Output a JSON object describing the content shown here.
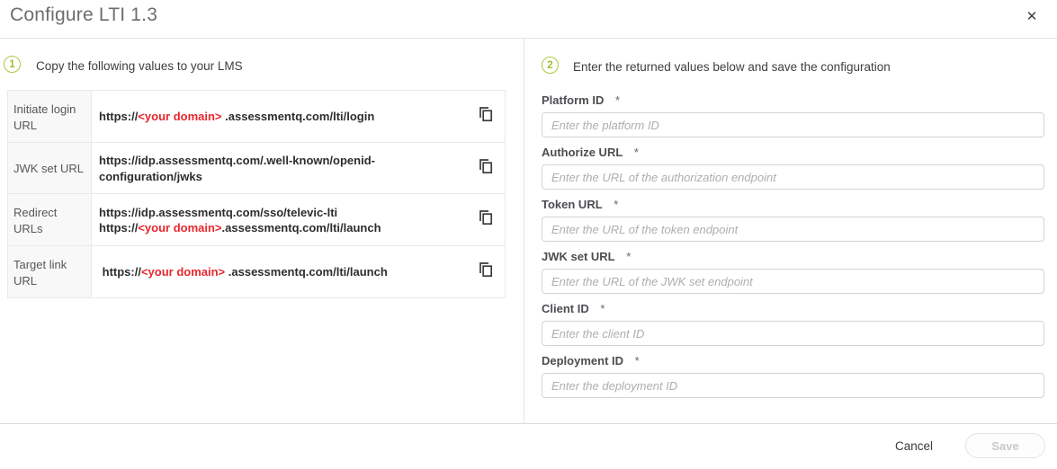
{
  "dialog": {
    "title": "Configure LTI 1.3",
    "close_icon": "✕"
  },
  "colors": {
    "accent_green": "#a9c83e",
    "highlight_red": "#e8262d"
  },
  "step1": {
    "number": "1",
    "instruction": "Copy the following values to your LMS",
    "table": {
      "rows": [
        {
          "label": "Initiate login URL",
          "copy_icon": "copy-icon",
          "lines": [
            [
              {
                "text": "https://"
              },
              {
                "text": "<your domain>",
                "red": true
              },
              {
                "text": " .assessmentq.com/lti/login"
              }
            ]
          ]
        },
        {
          "label": "JWK set URL",
          "copy_icon": "copy-icon",
          "lines": [
            [
              {
                "text": "https://idp.assessmentq.com/.well-known/openid-configuration/jwks"
              }
            ]
          ]
        },
        {
          "label": "Redirect URLs",
          "copy_icon": "copy-icon",
          "lines": [
            [
              {
                "text": "https://idp.assessmentq.com/sso/televic-lti"
              }
            ],
            [
              {
                "text": "https://"
              },
              {
                "text": "<your domain>",
                "red": true
              },
              {
                "text": ".assessmentq.com/lti/launch"
              }
            ]
          ]
        },
        {
          "label": "Target link URL",
          "copy_icon": "copy-icon",
          "lines": [
            [
              {
                "text": " https://"
              },
              {
                "text": "<your domain>",
                "red": true
              },
              {
                "text": " .assessmentq.com/lti/launch"
              }
            ]
          ]
        }
      ]
    }
  },
  "step2": {
    "number": "2",
    "instruction": "Enter the returned values below and save the configuration",
    "fields": [
      {
        "label": "Platform ID",
        "required": "*",
        "value": "",
        "placeholder": "Enter the platform ID"
      },
      {
        "label": "Authorize URL",
        "required": "*",
        "value": "",
        "placeholder": "Enter the URL of the authorization endpoint"
      },
      {
        "label": "Token URL",
        "required": "*",
        "value": "",
        "placeholder": "Enter the URL of the token endpoint"
      },
      {
        "label": "JWK set URL",
        "required": "*",
        "value": "",
        "placeholder": "Enter the URL of the JWK set endpoint"
      },
      {
        "label": "Client ID",
        "required": "*",
        "value": "",
        "placeholder": "Enter the client ID"
      },
      {
        "label": "Deployment ID",
        "required": "*",
        "value": "",
        "placeholder": "Enter the deployment ID"
      }
    ]
  },
  "footer": {
    "cancel_label": "Cancel",
    "save_label": "Save"
  }
}
